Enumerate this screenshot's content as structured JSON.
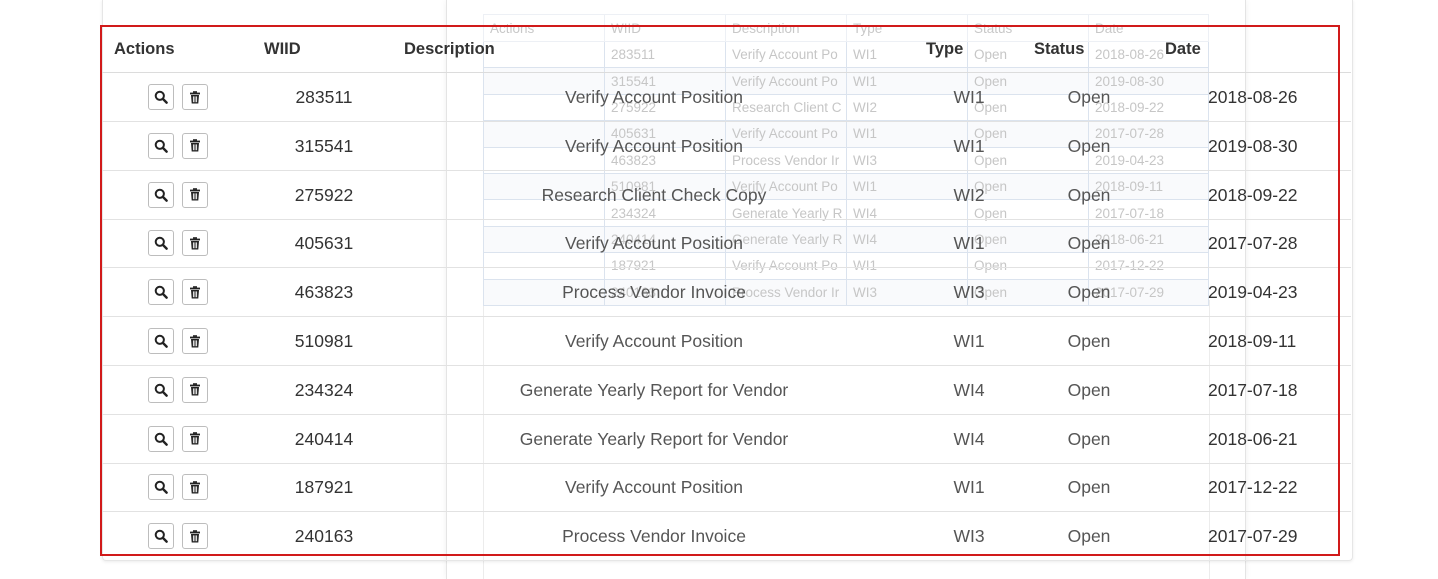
{
  "ghost_table": {
    "headers": [
      "Actions",
      "WIID",
      "Description",
      "Type",
      "Status",
      "Date"
    ],
    "rows": [
      [
        "",
        "283511",
        "Verify Account Po",
        "WI1",
        "Open",
        "2018-08-26"
      ],
      [
        "",
        "315541",
        "Verify Account Po",
        "WI1",
        "Open",
        "2019-08-30"
      ],
      [
        "",
        "275922",
        "Research Client C",
        "WI2",
        "Open",
        "2018-09-22"
      ],
      [
        "",
        "405631",
        "Verify Account Po",
        "WI1",
        "Open",
        "2017-07-28"
      ],
      [
        "",
        "463823",
        "Process Vendor Ir",
        "WI3",
        "Open",
        "2019-04-23"
      ],
      [
        "",
        "510981",
        "Verify Account Po",
        "WI1",
        "Open",
        "2018-09-11"
      ],
      [
        "",
        "234324",
        "Generate Yearly R",
        "WI4",
        "Open",
        "2017-07-18"
      ],
      [
        "",
        "240414",
        "Generate Yearly R",
        "WI4",
        "Open",
        "2018-06-21"
      ],
      [
        "",
        "187921",
        "Verify Account Po",
        "WI1",
        "Open",
        "2017-12-22"
      ],
      [
        "",
        "240163",
        "Process Vendor Ir",
        "WI3",
        "Open",
        "2017-07-29"
      ]
    ]
  },
  "grid": {
    "headers": {
      "actions": "Actions",
      "wiid": "WIID",
      "description": "Description",
      "type": "Type",
      "status": "Status",
      "date": "Date"
    },
    "rows": [
      {
        "wiid": "283511",
        "description": "Verify Account Position",
        "type": "WI1",
        "status": "Open",
        "date": "2018-08-26"
      },
      {
        "wiid": "315541",
        "description": "Verify Account Position",
        "type": "WI1",
        "status": "Open",
        "date": "2019-08-30"
      },
      {
        "wiid": "275922",
        "description": "Research Client Check Copy",
        "type": "WI2",
        "status": "Open",
        "date": "2018-09-22"
      },
      {
        "wiid": "405631",
        "description": "Verify Account Position",
        "type": "WI1",
        "status": "Open",
        "date": "2017-07-28"
      },
      {
        "wiid": "463823",
        "description": "Process Vendor Invoice",
        "type": "WI3",
        "status": "Open",
        "date": "2019-04-23"
      },
      {
        "wiid": "510981",
        "description": "Verify Account Position",
        "type": "WI1",
        "status": "Open",
        "date": "2018-09-11"
      },
      {
        "wiid": "234324",
        "description": "Generate Yearly Report for Vendor",
        "type": "WI4",
        "status": "Open",
        "date": "2017-07-18"
      },
      {
        "wiid": "240414",
        "description": "Generate Yearly Report for Vendor",
        "type": "WI4",
        "status": "Open",
        "date": "2018-06-21"
      },
      {
        "wiid": "187921",
        "description": "Verify Account Position",
        "type": "WI1",
        "status": "Open",
        "date": "2017-12-22"
      },
      {
        "wiid": "240163",
        "description": "Process Vendor Invoice",
        "type": "WI3",
        "status": "Open",
        "date": "2017-07-29"
      }
    ],
    "row_actions": [
      "search-icon",
      "trash-icon"
    ]
  },
  "colors": {
    "selection_border": "#d11a1a",
    "header_text": "#333333",
    "cell_text": "#555555",
    "row_divider": "#e2e2e2"
  }
}
